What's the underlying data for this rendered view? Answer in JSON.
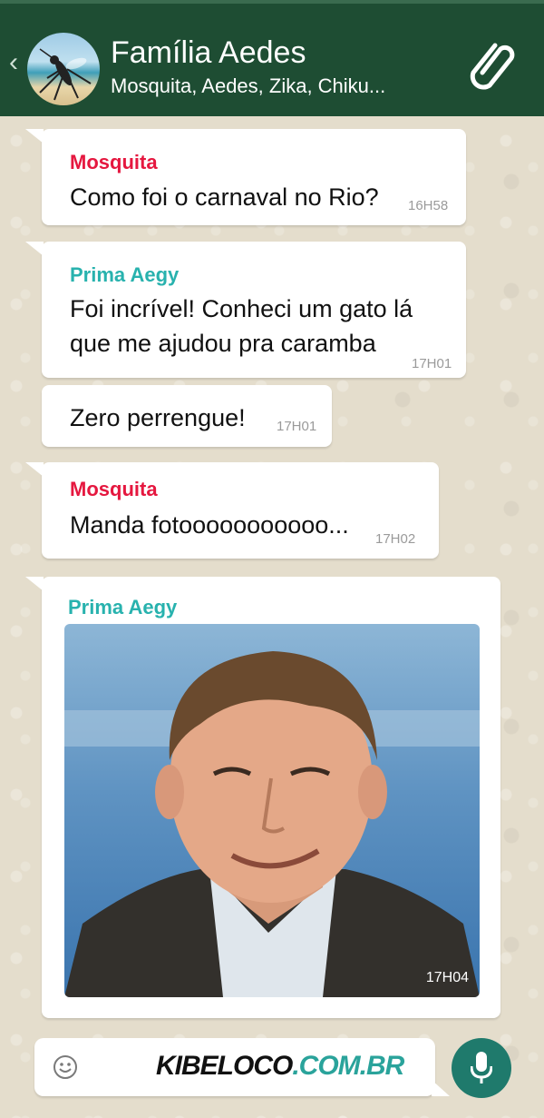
{
  "header": {
    "title": "Família Aedes",
    "subtitle": "Mosquita, Aedes, Zika, Chiku...",
    "back_icon": "chevron-left-icon",
    "attach_icon": "paperclip-icon",
    "avatar": "group-avatar-mosquito-beach"
  },
  "messages": [
    {
      "sender": "Mosquita",
      "text": "Como foi o carnaval no Rio?",
      "time": "16H58"
    },
    {
      "sender": "Prima Aegy",
      "text_line1": "Foi incrível! Conheci um gato lá",
      "text_line2": "que me ajudou pra caramba",
      "time": "17H01"
    },
    {
      "text": "Zero perrengue!",
      "time": "17H01"
    },
    {
      "sender": "Mosquita",
      "text": "Manda fotooooooooooo...",
      "time": "17H02"
    },
    {
      "sender": "Prima Aegy",
      "image": "photo-of-man-smiling",
      "time": "17H04"
    }
  ],
  "input": {
    "emoji_icon": "emoji-icon",
    "watermark_part1": "KIBELOCO",
    "watermark_part2": ".COM.BR",
    "mic_icon": "microphone-icon"
  },
  "colors": {
    "header_bg": "#1e4d33",
    "sender_red": "#e5173f",
    "sender_teal": "#28b2ae",
    "mic_bg": "#1f7a6c"
  }
}
